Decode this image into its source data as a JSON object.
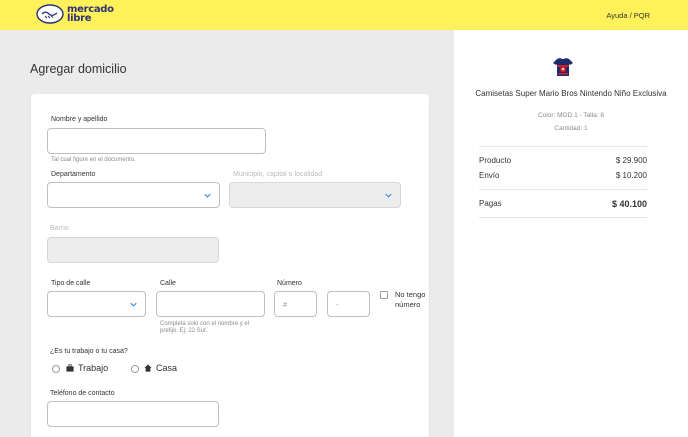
{
  "header": {
    "brand": {
      "line1": "mercado",
      "line2": "libre"
    },
    "help_link": "Ayuda / PQR"
  },
  "page": {
    "title": "Agregar domicilio"
  },
  "form": {
    "name": {
      "label": "Nombre y apellido",
      "value": "",
      "hint": "Tal cual figure en el documento."
    },
    "department": {
      "label": "Departamento",
      "value": ""
    },
    "municipality": {
      "label": "Municipio, capital o localidad",
      "value": ""
    },
    "neighborhood": {
      "label": "Barrio",
      "value": ""
    },
    "street_type": {
      "label": "Tipo de calle",
      "value": ""
    },
    "street": {
      "label": "Calle",
      "value": "",
      "hint": "Completa solo con el nombre y el prefijo. Ej: 22 Sur."
    },
    "number": {
      "label": "Número",
      "placeholder_main": "#",
      "placeholder_secondary": "-"
    },
    "no_number": {
      "label": "No tengo número",
      "checked": false
    },
    "place_type": {
      "question": "¿Es tu trabajo o tu casa?",
      "options": [
        {
          "label": "Trabajo",
          "icon": "briefcase-icon",
          "selected": false
        },
        {
          "label": "Casa",
          "icon": "house-icon",
          "selected": false
        }
      ]
    },
    "phone": {
      "label": "Teléfono de contacto",
      "value": ""
    }
  },
  "summary": {
    "product": {
      "image": "mario-shirt-thumbnail",
      "title": "Camisetas Super Mario Bros Nintendo Niño Exclusiva",
      "color": "Color: MOD 1 - Talla: 8",
      "quantity": "Cantidad: 1"
    },
    "rows": [
      {
        "label": "Producto",
        "value": "$ 29.900"
      },
      {
        "label": "Envío",
        "value": "$ 10.200"
      }
    ],
    "total": {
      "label": "Pagas",
      "value": "$ 40.100"
    }
  },
  "colors": {
    "header_bg": "#fff159",
    "accent": "#3483fa",
    "page_bg": "#ebebeb",
    "brand_text": "#2d3277"
  }
}
